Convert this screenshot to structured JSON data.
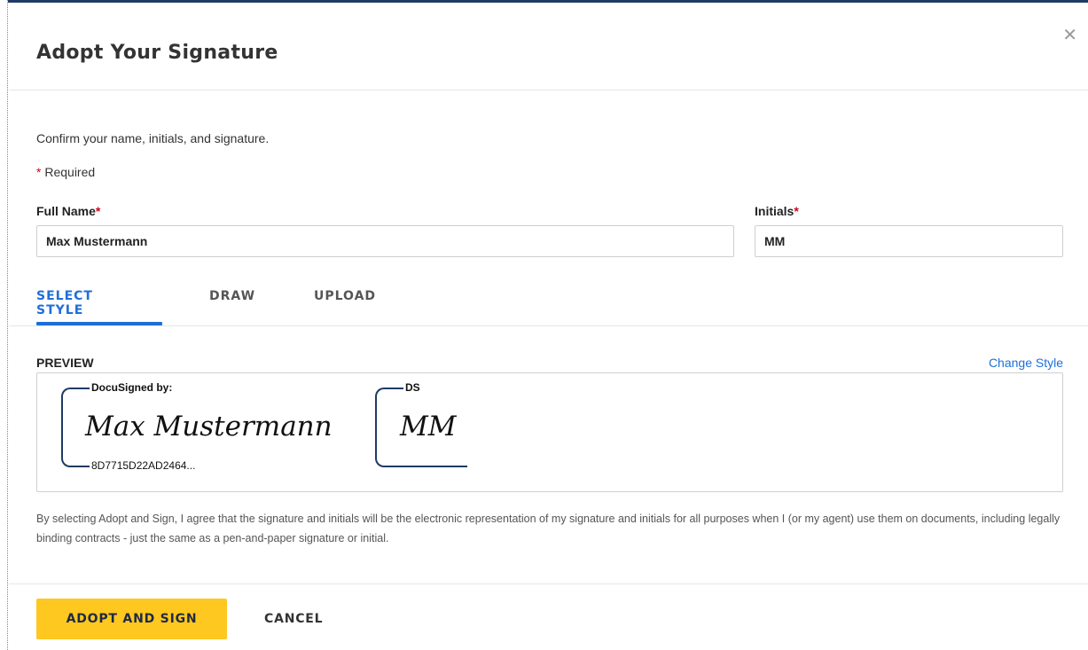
{
  "dialog": {
    "title": "Adopt Your Signature",
    "close_icon": "close-icon"
  },
  "form": {
    "instructions": "Confirm your name, initials, and signature.",
    "required_asterisk": "*",
    "required_note": "Required",
    "full_name": {
      "label": "Full Name",
      "asterisk": "*",
      "value": "Max Mustermann"
    },
    "initials": {
      "label": "Initials",
      "asterisk": "*",
      "value": "MM"
    }
  },
  "tabs": [
    {
      "label": "SELECT STYLE",
      "active": true
    },
    {
      "label": "DRAW",
      "active": false
    },
    {
      "label": "UPLOAD",
      "active": false
    }
  ],
  "preview": {
    "label": "PREVIEW",
    "change_style": "Change Style",
    "signature": {
      "header": "DocuSigned by:",
      "script": "Max Mustermann",
      "id": "8D7715D22AD2464..."
    },
    "initials": {
      "header": "DS",
      "script": "MM"
    }
  },
  "legal_text": "By selecting Adopt and Sign, I agree that the signature and initials will be the electronic representation of my signature and initials for all purposes when I (or my agent) use them on documents, including legally binding contracts - just the same as a pen-and-paper signature or initial.",
  "buttons": {
    "adopt": "ADOPT AND SIGN",
    "cancel": "CANCEL"
  },
  "colors": {
    "accent": "#1e6fd9",
    "primary_button": "#ffc820",
    "required": "#d0021b",
    "signature_frame": "#1f3b63"
  }
}
